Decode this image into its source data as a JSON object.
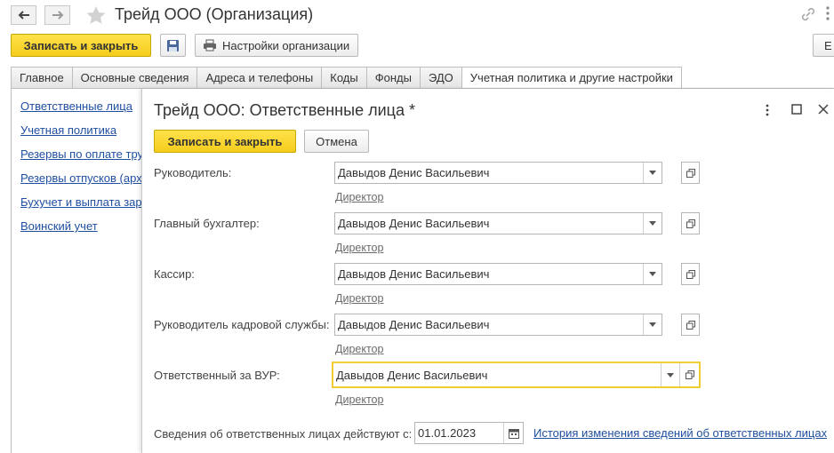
{
  "window": {
    "title": "Трейд ООО (Организация)",
    "toolbar": {
      "save_close": "Записать и закрыть",
      "settings": "Настройки организации",
      "more_cut": "Е"
    },
    "tabs": [
      "Главное",
      "Основные сведения",
      "Адреса и телефоны",
      "Коды",
      "Фонды",
      "ЭДО",
      "Учетная политика и другие настройки"
    ],
    "active_tab": 6
  },
  "left_nav": [
    "Ответственные лица",
    "Учетная политика",
    "Резервы по оплате тру",
    "Резервы отпусков (арх",
    "Бухучет и выплата зар",
    "Воинский учет"
  ],
  "modal": {
    "title": "Трейд ООО: Ответственные лица *",
    "save_close": "Записать и закрыть",
    "cancel": "Отмена",
    "rows": [
      {
        "label": "Руководитель:",
        "value": "Давыдов Денис Васильевич",
        "position": "Директор"
      },
      {
        "label": "Главный бухгалтер:",
        "value": "Давыдов Денис Васильевич",
        "position": "Директор"
      },
      {
        "label": "Кассир:",
        "value": "Давыдов Денис Васильевич",
        "position": "Директор"
      },
      {
        "label": "Руководитель кадровой службы:",
        "value": "Давыдов Денис Васильевич",
        "position": "Директор"
      },
      {
        "label": "Ответственный за ВУР:",
        "value": "Давыдов Денис Васильевич",
        "position": "Директор"
      }
    ],
    "effective_label": "Сведения об ответственных лицах действуют с:",
    "effective_date": "01.01.2023",
    "history_link": "История изменения сведений об ответственных лицах"
  },
  "colors": {
    "accent_yellow": "#f4cc1c",
    "link_blue": "#1f4fa0",
    "focus_border": "#f2cc33"
  }
}
